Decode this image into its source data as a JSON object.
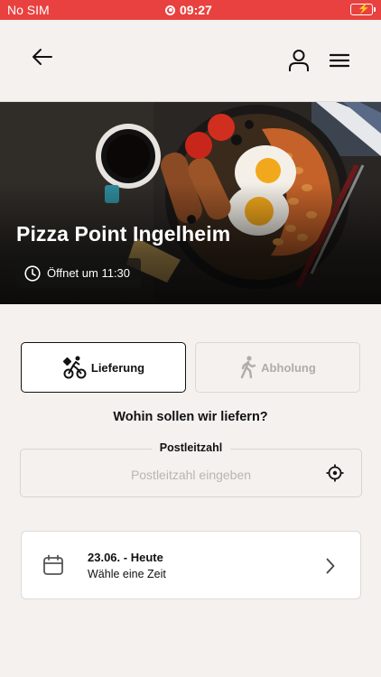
{
  "status_bar": {
    "carrier": "No SIM",
    "time": "09:27"
  },
  "header": {
    "back_icon": "arrow-left-icon",
    "profile_icon": "user-icon",
    "menu_icon": "hamburger-menu-icon"
  },
  "restaurant": {
    "name": "Pizza Point Ingelheim",
    "hours": "Öffnet um 11:30"
  },
  "order_mode": {
    "delivery_label": "Lieferung",
    "pickup_label": "Abholung",
    "selected": "delivery"
  },
  "delivery": {
    "question": "Wohin sollen wir liefern?",
    "postal_label": "Postleitzahl",
    "postal_placeholder": "Postleitzahl eingeben",
    "postal_value": ""
  },
  "schedule": {
    "date": "23.06. - Heute",
    "hint": "Wähle eine Zeit"
  },
  "colors": {
    "status_bar": "#e9413f",
    "background": "#f4f1ef",
    "text": "#111111",
    "battery": "#4cd964"
  }
}
